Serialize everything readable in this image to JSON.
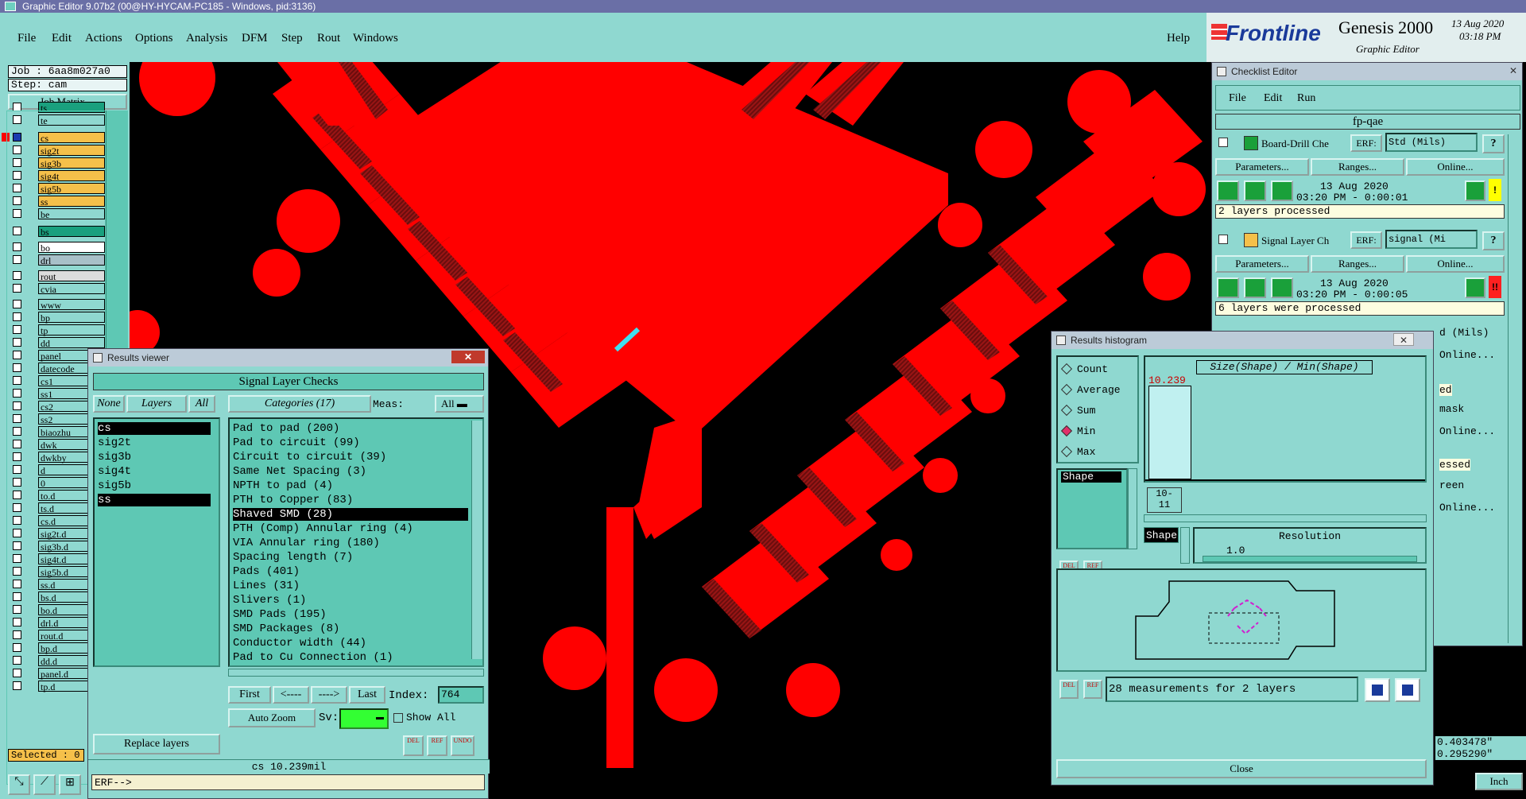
{
  "window_title": "Graphic Editor 9.07b2 (00@HY-HYCAM-PC185 - Windows, pid:3136)",
  "menu": [
    "File",
    "Edit",
    "Actions",
    "Options",
    "Analysis",
    "DFM",
    "Step",
    "Rout",
    "Windows"
  ],
  "help_label": "Help",
  "brand": {
    "name": "Frontline",
    "product": "Genesis 2000",
    "subtitle": "Graphic Editor",
    "date": "13 Aug 2020",
    "time": "03:18 PM"
  },
  "job": {
    "job": "Job : 6aa8m027a0",
    "step": "Step: cam",
    "matrix_btn": "Job Matrix ..."
  },
  "layers": [
    {
      "name": "ts",
      "color": "#1aa07e"
    },
    {
      "name": "te",
      "color": "#8fd8d0"
    },
    {
      "name": "cs",
      "color": "#f5c04a",
      "active": true
    },
    {
      "name": "sig2t",
      "color": "#f5c04a"
    },
    {
      "name": "sig3b",
      "color": "#f5c04a"
    },
    {
      "name": "sig4t",
      "color": "#f5c04a"
    },
    {
      "name": "sig5b",
      "color": "#f5c04a"
    },
    {
      "name": "ss",
      "color": "#f5c04a"
    },
    {
      "name": "be",
      "color": "#8fd8d0"
    },
    {
      "name": "bs",
      "color": "#1aa07e"
    },
    {
      "name": "bo",
      "color": "#ffffff"
    },
    {
      "name": "drl",
      "color": "#a8c0c8"
    },
    {
      "name": "rout",
      "color": "#dcdcdc"
    },
    {
      "name": "cvia",
      "color": "#8fd8d0"
    },
    {
      "name": "www",
      "color": "#8fd8d0"
    },
    {
      "name": "bp",
      "color": "#8fd8d0"
    },
    {
      "name": "tp",
      "color": "#8fd8d0"
    },
    {
      "name": "dd",
      "color": "#8fd8d0"
    },
    {
      "name": "panel",
      "color": "#8fd8d0"
    },
    {
      "name": "datecode",
      "color": "#8fd8d0"
    },
    {
      "name": "cs1",
      "color": "#8fd8d0"
    },
    {
      "name": "ss1",
      "color": "#8fd8d0"
    },
    {
      "name": "cs2",
      "color": "#8fd8d0"
    },
    {
      "name": "ss2",
      "color": "#8fd8d0"
    },
    {
      "name": "biaozhu",
      "color": "#8fd8d0"
    },
    {
      "name": "dwk",
      "color": "#8fd8d0"
    },
    {
      "name": "dwkby",
      "color": "#8fd8d0"
    },
    {
      "name": "d",
      "color": "#8fd8d0"
    },
    {
      "name": "0",
      "color": "#8fd8d0"
    },
    {
      "name": "to.d",
      "color": "#8fd8d0"
    },
    {
      "name": "ts.d",
      "color": "#8fd8d0"
    },
    {
      "name": "cs.d",
      "color": "#8fd8d0"
    },
    {
      "name": "sig2t.d",
      "color": "#8fd8d0"
    },
    {
      "name": "sig3b.d",
      "color": "#8fd8d0"
    },
    {
      "name": "sig4t.d",
      "color": "#8fd8d0"
    },
    {
      "name": "sig5b.d",
      "color": "#8fd8d0"
    },
    {
      "name": "ss.d",
      "color": "#8fd8d0"
    },
    {
      "name": "bs.d",
      "color": "#8fd8d0"
    },
    {
      "name": "bo.d",
      "color": "#8fd8d0"
    },
    {
      "name": "drl.d",
      "color": "#8fd8d0"
    },
    {
      "name": "rout.d",
      "color": "#8fd8d0"
    },
    {
      "name": "bp.d",
      "color": "#8fd8d0"
    },
    {
      "name": "dd.d",
      "color": "#8fd8d0"
    },
    {
      "name": "panel.d",
      "color": "#8fd8d0"
    },
    {
      "name": "tp.d",
      "color": "#8fd8d0"
    }
  ],
  "selected_label": "Selected : 0",
  "results_viewer": {
    "title": "Results viewer",
    "header": "Signal Layer Checks",
    "none_btn": "None",
    "layers_btn": "Layers",
    "all_btn": "All",
    "categories_btn": "Categories (17)",
    "meas_label": "Meas:",
    "meas_value": "All",
    "layers": [
      "cs",
      "sig2t",
      "sig3b",
      "sig4t",
      "sig5b",
      "ss"
    ],
    "categories": [
      "Pad to pad (200)",
      "Pad to circuit (99)",
      "Circuit to circuit (39)",
      "Same Net Spacing (3)",
      "NPTH to pad (4)",
      "PTH to Copper (83)",
      "Shaved SMD (28)",
      "PTH (Comp) Annular ring (4)",
      "VIA Annular ring (180)",
      "Spacing length (7)",
      "Pads (401)",
      "Lines (31)",
      "Slivers (1)",
      "SMD Pads (195)",
      "SMD Packages (8)",
      "Conductor width (44)",
      "Pad to Cu Connection (1)"
    ],
    "first_btn": "First",
    "prev_btn": "<----",
    "next_btn": "---->",
    "last_btn": "Last",
    "index_label": "Index:",
    "index_value": "764",
    "autozoom": "Auto Zoom",
    "sv_label": "Sv:",
    "show_all": "Show All",
    "replace_layers": "Replace layers",
    "del": "DEL",
    "ref": "REF",
    "undo": "UNDO",
    "status": "cs 10.239mil"
  },
  "erf_prompt": "ERF-->",
  "checklist": {
    "title": "Checklist Editor",
    "menu": [
      "File",
      "Edit",
      "Run"
    ],
    "name": "fp-qae",
    "checks": [
      {
        "name": "Board-Drill Che",
        "erf": "ERF:",
        "erf_value": "Std (Mils)",
        "date": "13 Aug 2020",
        "time": "03:20 PM - 0:00:01",
        "status": "2 layers processed",
        "flag": "!",
        "flag_color": "#ffff00"
      },
      {
        "name": "Signal Layer Ch",
        "erf": "ERF:",
        "erf_value": "signal (Mi",
        "date": "13 Aug 2020",
        "time": "03:20 PM - 0:00:05",
        "status": "6 layers were processed",
        "flag": "!!",
        "flag_color": "#ff2020"
      }
    ],
    "params_btn": "Parameters...",
    "ranges_btn": "Ranges...",
    "online_btn": "Online...",
    "behind": [
      "d (Mils)",
      "Online...",
      "ed",
      "mask",
      "Online...",
      "essed",
      "reen",
      "Online..."
    ]
  },
  "histogram": {
    "title": "Results histogram",
    "options": [
      "Count",
      "Average",
      "Sum",
      "Min",
      "Max"
    ],
    "selected_option": "Min",
    "list": [
      "Shape"
    ],
    "chart_title": "Size(Shape) / Min(Shape)",
    "bar_value": "10.239",
    "bin_label_1": "10-",
    "bin_label_2": "11",
    "shape_label": "Shape",
    "resolution_label": "Resolution",
    "resolution_value": "1.0",
    "measurements": "28 measurements for 2 layers",
    "close_btn": "Close"
  },
  "coords": {
    "x": "0.403478\"",
    "y": "0.295290\"",
    "unit": "Inch"
  }
}
